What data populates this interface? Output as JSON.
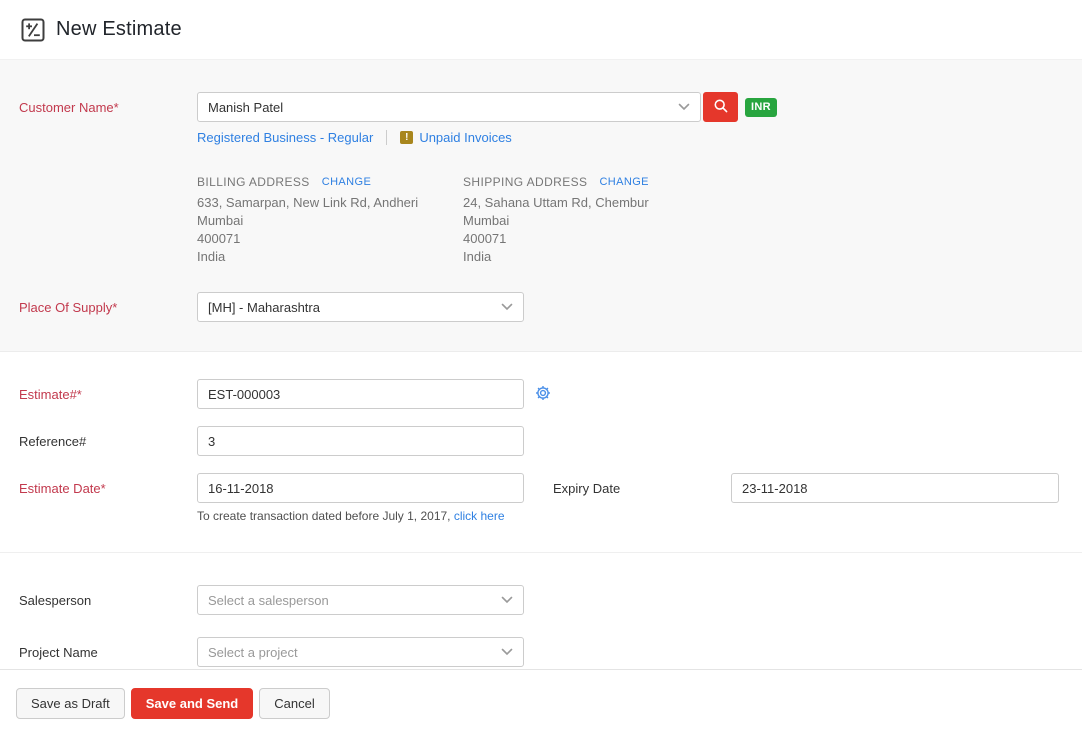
{
  "header": {
    "title": "New Estimate"
  },
  "customer": {
    "label": "Customer Name*",
    "value": "Manish Patel",
    "currency_badge": "INR",
    "gst_link": "Registered Business - Regular",
    "warning_glyph": "!",
    "unpaid_link": "Unpaid Invoices"
  },
  "billing": {
    "heading": "BILLING ADDRESS",
    "change_label": "CHANGE",
    "lines": [
      "633, Samarpan, New Link Rd, Andheri",
      "Mumbai",
      "400071",
      "India"
    ]
  },
  "shipping": {
    "heading": "SHIPPING ADDRESS",
    "change_label": "CHANGE",
    "lines": [
      "24, Sahana Uttam Rd, Chembur",
      "Mumbai",
      "400071",
      "India"
    ]
  },
  "place_of_supply": {
    "label": "Place Of Supply*",
    "value": "[MH] - Maharashtra"
  },
  "estimate_number": {
    "label": "Estimate#*",
    "value": "EST-000003"
  },
  "reference": {
    "label": "Reference#",
    "value": "3"
  },
  "estimate_date": {
    "label": "Estimate Date*",
    "value": "16-11-2018",
    "helper_text": "To create transaction dated before July 1, 2017,",
    "helper_link": "click here"
  },
  "expiry_date": {
    "label": "Expiry Date",
    "value": "23-11-2018"
  },
  "salesperson": {
    "label": "Salesperson",
    "placeholder": "Select a salesperson"
  },
  "project": {
    "label": "Project Name",
    "placeholder": "Select a project"
  },
  "footer": {
    "save_draft_label": "Save as Draft",
    "save_send_label": "Save and Send",
    "cancel_label": "Cancel"
  },
  "icons": {
    "header": "estimate-icon",
    "search": "search-icon",
    "settings": "gear-icon",
    "warning": "warning-icon",
    "chevron": "chevron-down-icon"
  },
  "colors": {
    "accent_red": "#e5372b",
    "link_blue": "#2f80e2",
    "label_red": "#c2394d",
    "badge_green": "#28a53f",
    "warning_gold": "#a8861d"
  }
}
